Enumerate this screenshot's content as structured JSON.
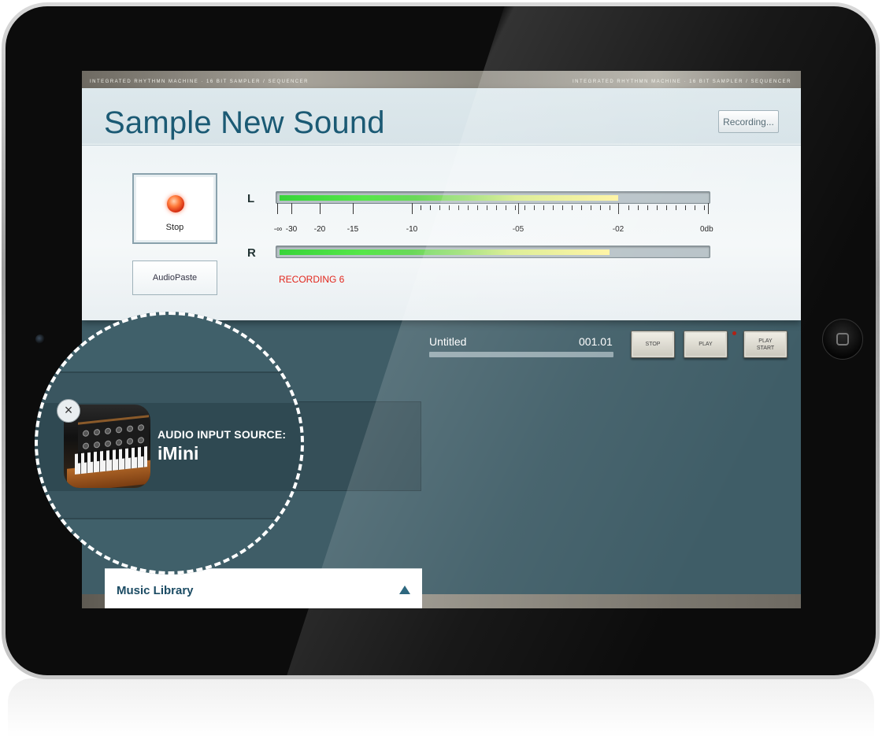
{
  "header_strip": {
    "left_text": "INTEGRATED RHYTHMN MACHINE · 16 BIT SAMPLER / SEQUENCER",
    "right_text": "INTEGRATED RHYTHMN MACHINE · 16 BIT SAMPLER / SEQUENCER"
  },
  "sampler": {
    "title": "Sample New Sound",
    "recording_button": "Recording...",
    "stop_button": "Stop",
    "audiopaste_button": "AudioPaste",
    "status": "RECORDING 6",
    "meters": {
      "left_label": "L",
      "right_label": "R",
      "left_level": 0.79,
      "right_level": 0.77,
      "scale_labels": [
        "-∞",
        "-30",
        "-20",
        "-15",
        "-10",
        "-05",
        "-02",
        "0db"
      ]
    }
  },
  "transport": {
    "song_title": "Untitled",
    "song_position": "001.01",
    "stop_label": "STOP",
    "play_label": "PLAY",
    "play_start_label": "PLAY START"
  },
  "audio_source": {
    "caption": "AUDIO INPUT SOURCE:",
    "name": "iMini",
    "icon": "synthesizer-app-icon"
  },
  "music_library": {
    "label": "Music Library"
  },
  "colors": {
    "title_blue": "#1b5a74",
    "recording_red": "#e2261c",
    "lower_bg": "#3f5d67"
  }
}
